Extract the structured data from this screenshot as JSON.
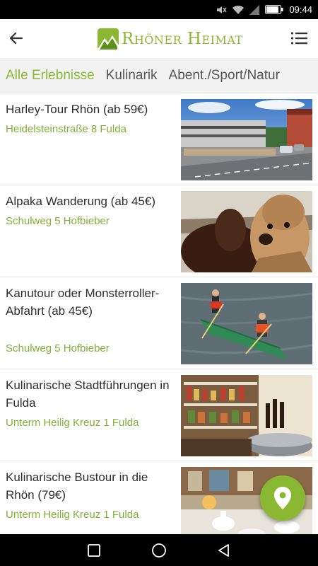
{
  "status_bar": {
    "time": "09:44"
  },
  "app": {
    "logo_text": "Rhöner Heimat"
  },
  "tabs": [
    {
      "label": "Alle Erlebnisse"
    },
    {
      "label": "Kulinarik"
    },
    {
      "label": "Abent./Sport/Natur"
    }
  ],
  "items": [
    {
      "title": "Harley-Tour Rhön (ab 59€)",
      "address": "Heidelsteinstraße 8 Fulda"
    },
    {
      "title": "Alpaka Wanderung (ab 45€)",
      "address": "Schulweg 5 Hofbieber"
    },
    {
      "title": "Kanutour oder Monsterroller-Abfahrt (ab 45€)",
      "address": "Schulweg 5 Hofbieber"
    },
    {
      "title": "Kulinarische Stadtführungen in Fulda",
      "address": "Unterm Heilig Kreuz 1 Fulda"
    },
    {
      "title": "Kulinarische Bustour in die Rhön (79€)",
      "address": "Unterm Heilig Kreuz 1 Fulda"
    }
  ],
  "colors": {
    "accent": "#8ab832",
    "address": "#7fb136",
    "tab_bg": "#f2f2f2"
  },
  "icons": {
    "back": "arrow-left-icon",
    "menu": "list-menu-icon",
    "fab": "map-pin-icon",
    "nav_recent": "square-icon",
    "nav_home": "circle-icon",
    "nav_back": "triangle-back-icon"
  }
}
